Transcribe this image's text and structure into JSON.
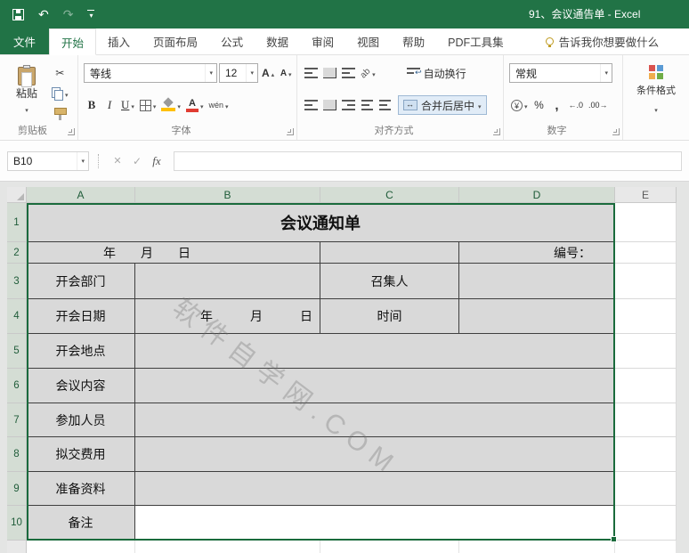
{
  "colors": {
    "accent": "#217346",
    "cell_fill": "#d9d9d9",
    "selection_border": "#1a6b3c"
  },
  "titlebar": {
    "title": "91、会议通告单 - Excel"
  },
  "tabs": {
    "file": "文件",
    "items": [
      "开始",
      "插入",
      "页面布局",
      "公式",
      "数据",
      "审阅",
      "视图",
      "帮助",
      "PDF工具集"
    ],
    "tell_me": "告诉我你想要做什么"
  },
  "ribbon": {
    "paste": "粘贴",
    "font_name": "等线",
    "font_size": "12",
    "letter_a": "A",
    "bold": "B",
    "italic": "I",
    "underline": "U",
    "phonetic": "wén",
    "orient": "ab",
    "wrap": "自动换行",
    "merge": "合并后居中",
    "number_format": "常规",
    "currency": "¥",
    "percent": "%",
    "comma": ",",
    "dec_increase": "←.0",
    "dec_decrease": ".00→",
    "conditional": "条件格式",
    "groups": {
      "clipboard": "剪贴板",
      "font": "字体",
      "alignment": "对齐方式",
      "number": "数字"
    }
  },
  "formula_bar": {
    "name_box": "B10",
    "fx": "fx"
  },
  "sheet": {
    "columns": [
      "A",
      "B",
      "C",
      "D",
      "E"
    ],
    "rows": [
      "1",
      "2",
      "3",
      "4",
      "5",
      "6",
      "7",
      "8",
      "9",
      "10"
    ],
    "active_cell": "B10",
    "cells": {
      "title": "会议通知单",
      "date_top": "年　　月　　日",
      "no_label": "编号：",
      "dept": "开会部门",
      "convener": "召集人",
      "date": "开会日期",
      "date_mid": "年　　　月　　　日",
      "time": "时间",
      "place": "开会地点",
      "content": "会议内容",
      "attendees": "参加人员",
      "fee": "拟交费用",
      "materials": "准备资料",
      "remark": "备注"
    }
  },
  "watermark": "软件自学网.COM"
}
